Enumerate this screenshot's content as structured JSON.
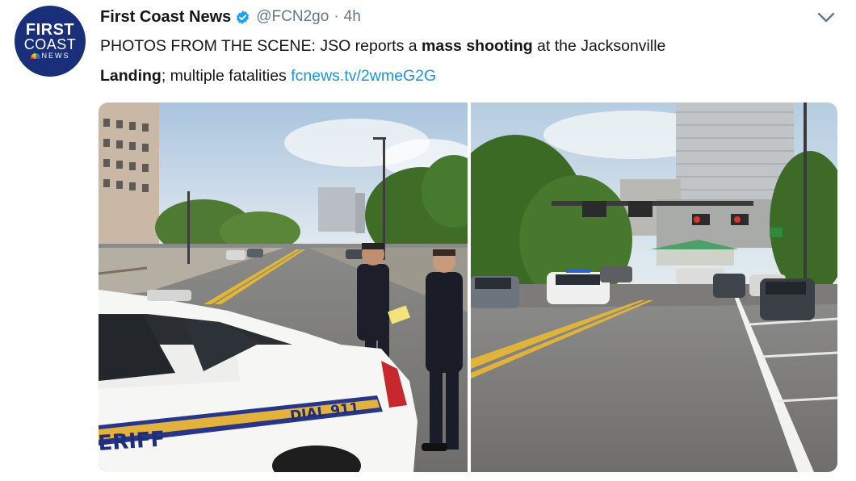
{
  "tweet": {
    "author_name": "First Coast News",
    "handle": "@FCN2go",
    "separator": "·",
    "time": "4h",
    "avatar": {
      "line1": "FIRST",
      "line2": "COAST",
      "line3": "NEWS"
    },
    "text": {
      "part1": "PHOTOS FROM THE SCENE: JSO reports a ",
      "bold1": "mass shooting",
      "part2": " at the Jacksonville ",
      "bold2": "Landing",
      "part3": "; multiple fatalities ",
      "link": "fcnews.tv/2wmeG2G"
    },
    "photos": [
      {
        "car_text_1": "DIAL 911",
        "car_text_2": "ERIFF"
      },
      {}
    ],
    "icons": {
      "verified": "verified-badge-icon",
      "menu": "chevron-down-icon"
    },
    "colors": {
      "link": "#1b95e0",
      "verified": "#1da1f2",
      "muted": "#657786",
      "avatar_bg": "#1a2f7a"
    }
  }
}
